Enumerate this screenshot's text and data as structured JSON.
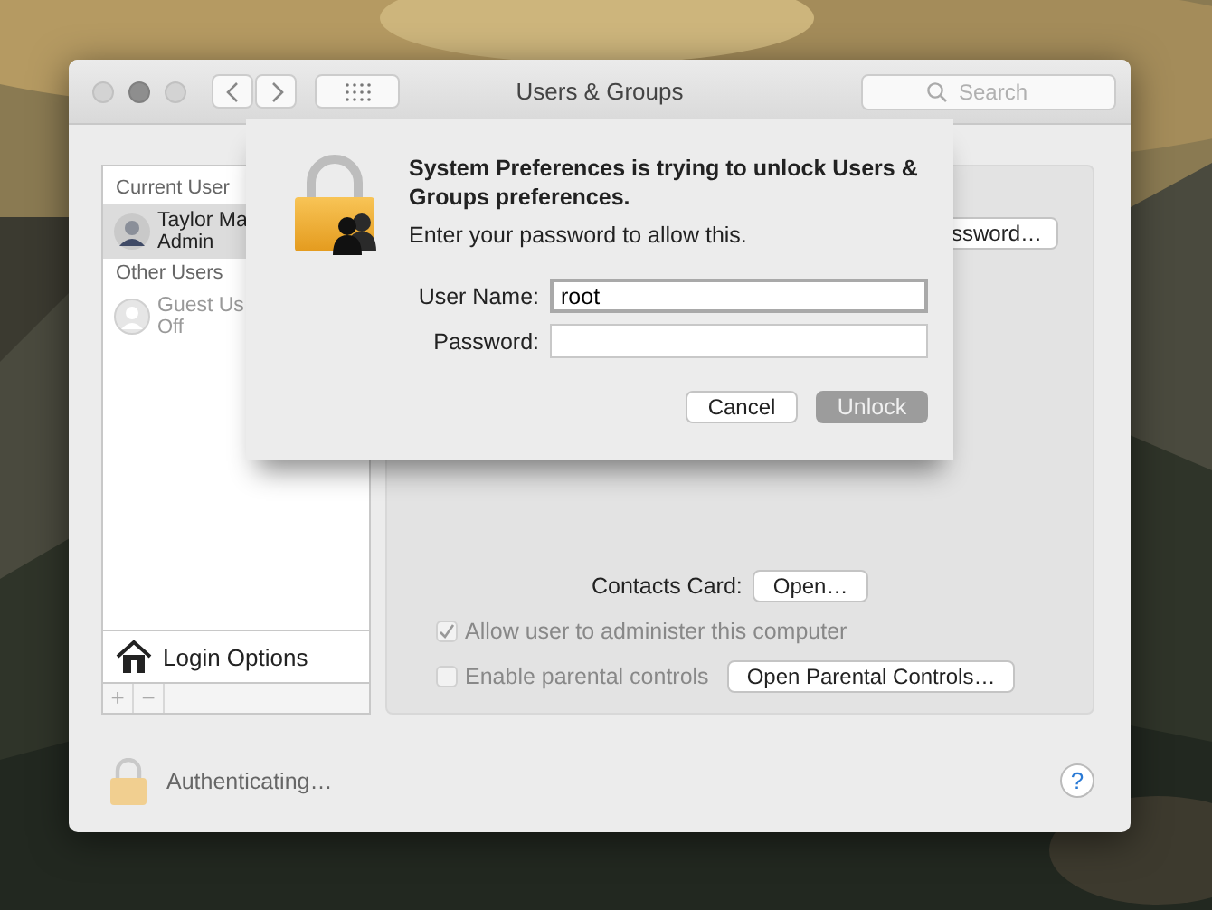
{
  "window": {
    "title": "Users & Groups",
    "search": {
      "placeholder": "Search"
    }
  },
  "sidebar": {
    "sections": [
      {
        "heading": "Current User",
        "users": [
          {
            "name": "Taylor Ma",
            "role": "Admin",
            "selected": true
          }
        ]
      },
      {
        "heading": "Other Users",
        "users": [
          {
            "name": "Guest Us",
            "role": "Off",
            "selected": false,
            "kind": "guest"
          }
        ]
      }
    ],
    "login_options": "Login Options",
    "add_button": "+",
    "remove_button": "−"
  },
  "detail": {
    "password_button": "ssword…",
    "contacts_label": "Contacts Card:",
    "contacts_button": "Open…",
    "checkboxes": [
      {
        "label": "Allow user to administer this computer",
        "checked": true
      },
      {
        "label": "Enable parental controls",
        "checked": false
      }
    ],
    "parental_button": "Open Parental Controls…"
  },
  "status": "Authenticating…",
  "help": "?",
  "dialog": {
    "title": "System Preferences is trying to unlock Users & Groups preferences.",
    "message": "Enter your password to allow this.",
    "fields": [
      {
        "label": "User Name:",
        "value": "root",
        "focused": true
      },
      {
        "label": "Password:",
        "focused": false
      }
    ],
    "cancel_button": "Cancel",
    "unlock_button": "Unlock"
  }
}
